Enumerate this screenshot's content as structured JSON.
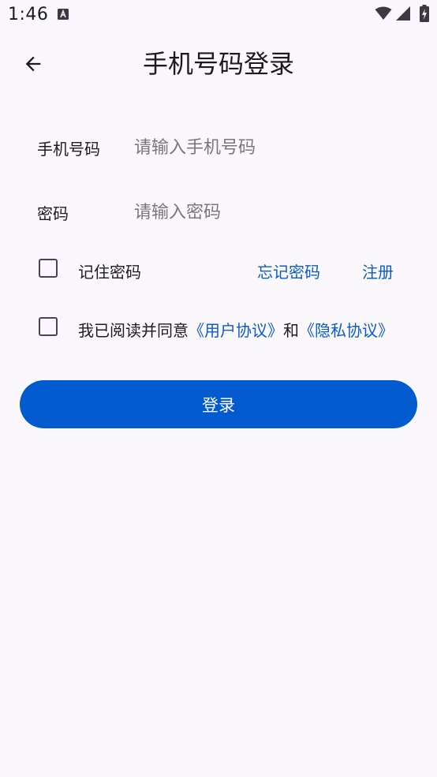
{
  "status_bar": {
    "time": "1:46",
    "icons": [
      "a-notification-icon",
      "wifi-icon",
      "signal-icon",
      "battery-charging-icon"
    ]
  },
  "header": {
    "title": "手机号码登录",
    "back_icon": "arrow-left-icon"
  },
  "form": {
    "phone_label": "手机号码",
    "phone_placeholder": "请输入手机号码",
    "phone_value": "",
    "password_label": "密码",
    "password_placeholder": "请输入密码",
    "password_value": ""
  },
  "options": {
    "remember_password": "记住密码",
    "remember_checked": false,
    "forgot_password": "忘记密码",
    "register": "注册"
  },
  "agreement": {
    "checked": false,
    "prefix": "我已阅读并同意",
    "user_agreement": "《用户协议》",
    "conjunction": "和",
    "privacy_policy": "《隐私协议》"
  },
  "login_button": "登录",
  "colors": {
    "background": "#fbf8fd",
    "primary": "#015bce",
    "link": "#0a5bc9",
    "text": "#1d1b20",
    "placeholder": "#7a767c"
  }
}
